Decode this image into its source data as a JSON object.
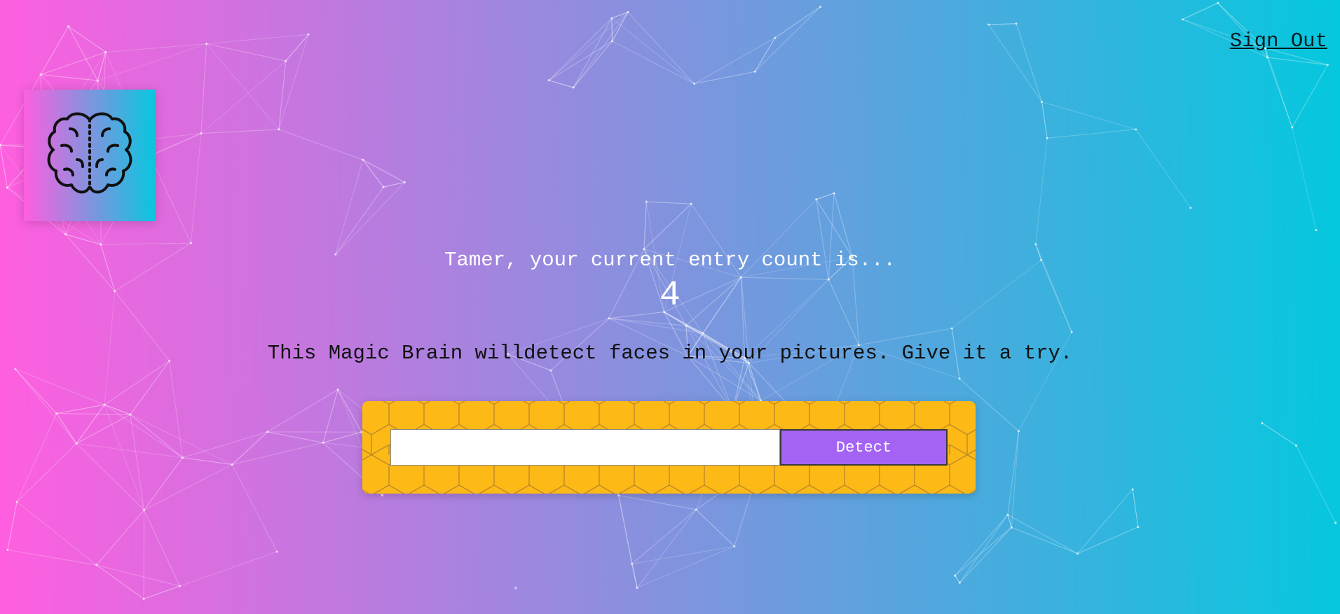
{
  "nav": {
    "sign_out_label": "Sign Out"
  },
  "logo": {
    "icon": "brain-icon"
  },
  "rank": {
    "message": "Tamer, your current entry count is...",
    "count": "4"
  },
  "tagline": "This Magic Brain willdetect faces in your pictures. Give it a try.",
  "form": {
    "input_value": "",
    "detect_label": "Detect"
  },
  "colors": {
    "gradient_start": "#ff5edf",
    "gradient_end": "#04c8de",
    "panel": "#fdb916",
    "button": "#a463f2"
  }
}
